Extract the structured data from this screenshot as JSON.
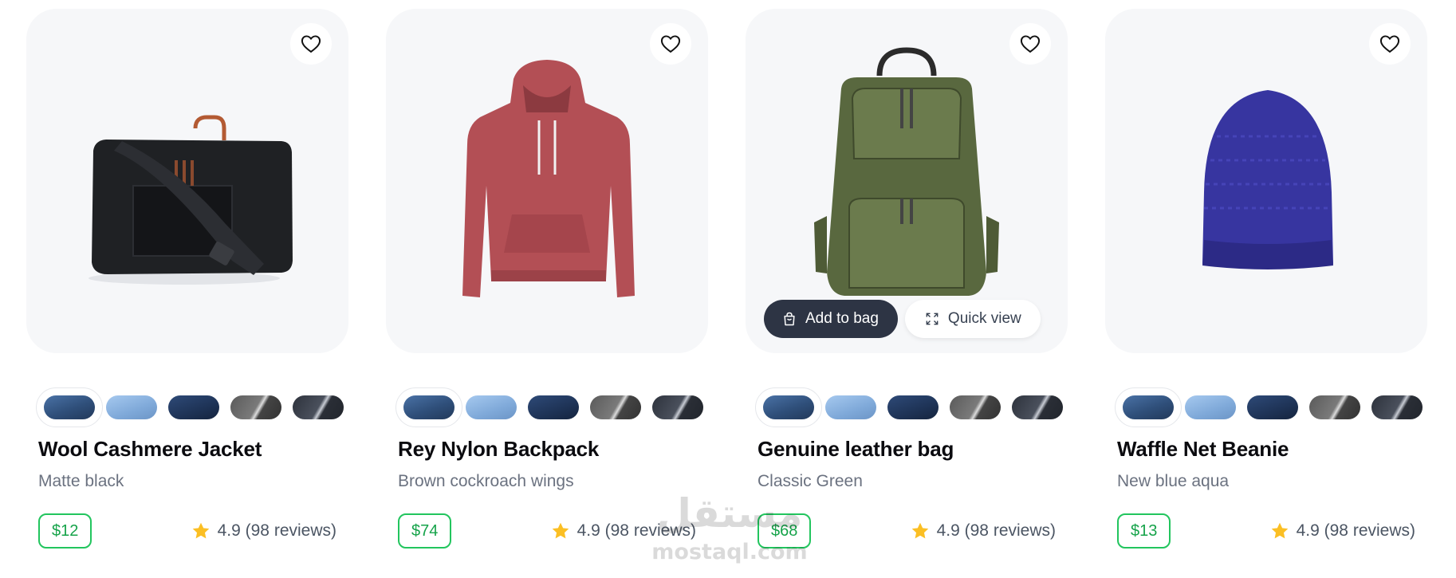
{
  "products": [
    {
      "name": "Wool Cashmere Jacket",
      "subtitle": "Matte black",
      "price": "$12",
      "rating_text": "4.9 (98 reviews)",
      "image": "black-travel-bag"
    },
    {
      "name": "Rey Nylon Backpack",
      "subtitle": "Brown cockroach wings",
      "price": "$74",
      "rating_text": "4.9 (98 reviews)",
      "image": "red-hoodie"
    },
    {
      "name": "Genuine leather bag",
      "subtitle": "Classic Green",
      "price": "$68",
      "rating_text": "4.9 (98 reviews)",
      "image": "green-backpack"
    },
    {
      "name": "Waffle Net Beanie",
      "subtitle": "New blue aqua",
      "price": "$13",
      "rating_text": "4.9 (98 reviews)",
      "image": "blue-beanie"
    }
  ],
  "hover_actions": {
    "add_to_bag_label": "Add to bag",
    "quick_view_label": "Quick view"
  },
  "icons": {
    "favorite": "heart-icon",
    "rating": "star-icon",
    "bag": "shopping-bag-icon",
    "quick_view": "expand-icon"
  },
  "swatch_colors": [
    "#3b5f8f",
    "#8fb8e6",
    "#243b63",
    "#6b6b6b",
    "#3a3f4a"
  ],
  "colors": {
    "price_border": "#22c55e",
    "price_text": "#16a34a",
    "star": "#fbbf24",
    "add_to_bag_bg": "#2d3444",
    "card_bg": "#f6f7f9"
  },
  "watermark": {
    "arabic": "مستقل",
    "latin": "mostaql.com"
  }
}
